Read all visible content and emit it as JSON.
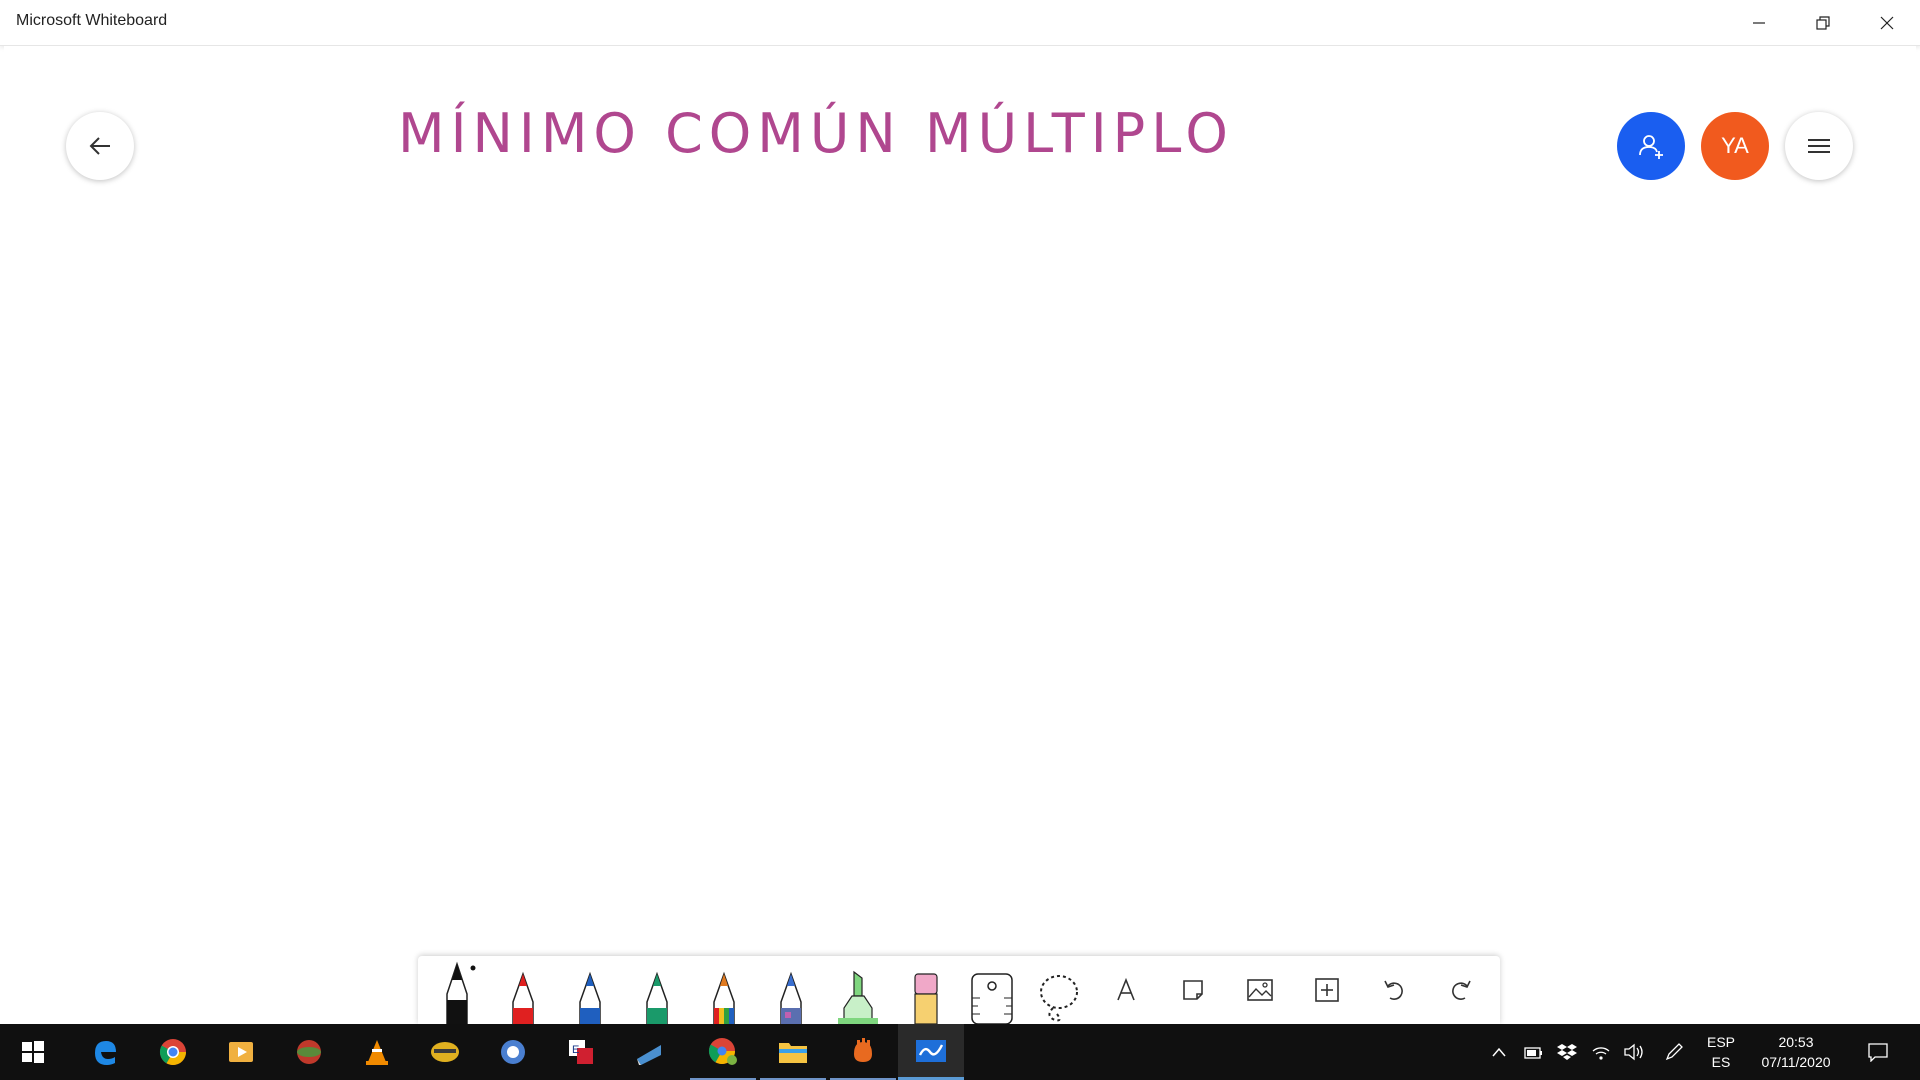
{
  "window": {
    "title": "Microsoft Whiteboard"
  },
  "board": {
    "title": "MÍNIMO COMÚN MÚLTIPLO",
    "title_color": "#b0478f"
  },
  "header": {
    "avatar_initials": "YA",
    "invite_color": "#1a5ef0",
    "avatar_color": "#f15a1e"
  },
  "toolbar": {
    "pens": [
      {
        "name": "black-pen",
        "color": "#111111"
      },
      {
        "name": "red-pen",
        "color": "#e02020"
      },
      {
        "name": "blue-pen",
        "color": "#1f5fbf"
      },
      {
        "name": "green-pen",
        "color": "#1a9a6a"
      },
      {
        "name": "rainbow-pen",
        "color": "#e07a20"
      },
      {
        "name": "galaxy-pen",
        "color": "#5a6fb0"
      },
      {
        "name": "highlighter",
        "color": "#7fd67f"
      }
    ],
    "tools": [
      "eraser-icon",
      "ruler-icon",
      "lasso-icon",
      "text-icon",
      "sticky-note-icon",
      "image-icon",
      "add-icon",
      "undo-icon",
      "redo-icon"
    ]
  },
  "taskbar": {
    "apps": [
      "start-icon",
      "edge-icon",
      "chrome-icon",
      "media-player-icon",
      "app-icon",
      "vlc-icon",
      "app-icon",
      "app-icon",
      "app-icon",
      "app-icon",
      "chrome-profile-icon",
      "file-explorer-icon",
      "app-icon",
      "whiteboard-icon"
    ],
    "language": {
      "line1": "ESP",
      "line2": "ES"
    },
    "clock": {
      "time": "20:53",
      "date": "07/11/2020"
    }
  }
}
